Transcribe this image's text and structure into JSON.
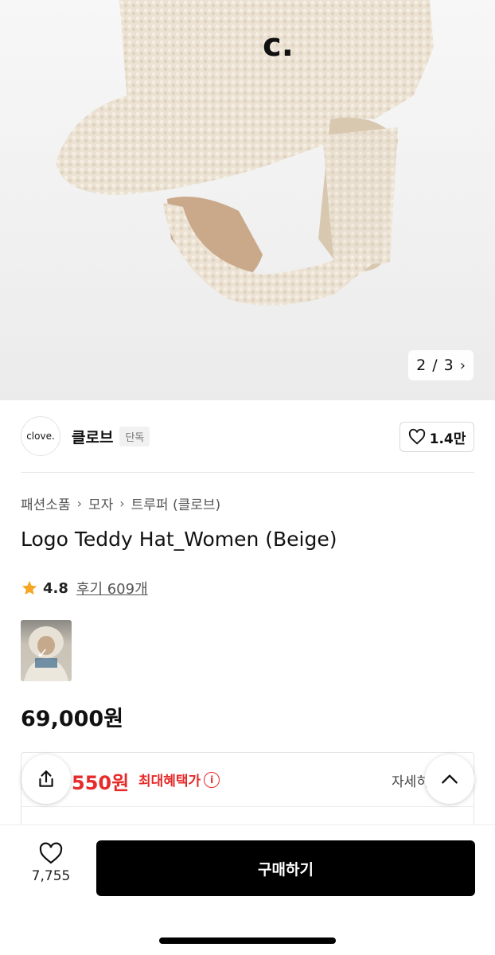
{
  "gallery": {
    "current": "2",
    "separator": "/",
    "total": "3",
    "logo_mark": "c."
  },
  "brand": {
    "logo_text": "clove.",
    "name": "클로브",
    "badge": "단독",
    "like_count": "1.4만"
  },
  "breadcrumb": [
    "패션소품",
    "모자",
    "트루퍼 (클로브)"
  ],
  "product": {
    "title": "Logo Teddy Hat_Women (Beige)",
    "price": "69,000원"
  },
  "rating": {
    "score": "4.8",
    "reviews": "후기 609개"
  },
  "benefit": {
    "price": "550원",
    "label": "최대혜택가",
    "info_icon": "i",
    "detail": "자세히"
  },
  "bottom": {
    "wish_count": "7,755",
    "buy_label": "구매하기"
  },
  "colors": {
    "accent_red": "#e62b2b",
    "buy_button": "#000000"
  }
}
